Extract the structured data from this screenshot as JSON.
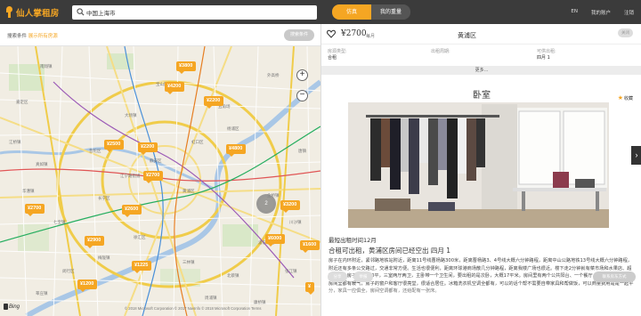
{
  "app": {
    "logo_text": "仙人掌租房"
  },
  "search": {
    "value": "中国上海市",
    "placeholder": ""
  },
  "tabs": [
    {
      "label": "仿真"
    },
    {
      "label": "我的重量"
    }
  ],
  "nav": [
    {
      "label": "EN"
    },
    {
      "label": "我的账户"
    },
    {
      "label": "注销"
    }
  ],
  "filter": {
    "text_prefix": "搜索条件 ",
    "text_highlight": "展示所有房源",
    "button_label": "搜索条件"
  },
  "map": {
    "pins": [
      {
        "label": "¥3800"
      },
      {
        "label": "¥4200"
      },
      {
        "label": "¥2200"
      },
      {
        "label": "¥2500"
      },
      {
        "label": "¥2200"
      },
      {
        "label": "¥4800"
      },
      {
        "label": "¥2700"
      },
      {
        "label": "¥2600"
      },
      {
        "label": "¥2700"
      },
      {
        "label": "¥3200"
      },
      {
        "label": "¥2900"
      },
      {
        "label": "¥6000"
      },
      {
        "label": "¥1600"
      },
      {
        "label": "¥1225"
      },
      {
        "label": "¥1200"
      },
      {
        "label": "¥"
      }
    ],
    "cluster_count": "2",
    "labels": [
      "宝山区",
      "嘉定区",
      "普陀区",
      "静安区",
      "黄浦区",
      "长宁区",
      "徐汇区",
      "闵行区",
      "浦东新区",
      "杨浦区",
      "虹口区",
      "江宁路街道",
      "真如镇",
      "外高桥",
      "张江镇",
      "北蔡镇",
      "三林镇",
      "梅陇镇",
      "莘庄镇",
      "七宝镇",
      "华漕镇",
      "江桥镇",
      "南翔镇",
      "大场镇",
      "五角场",
      "金桥镇",
      "康桥镇",
      "周浦镇",
      "川沙镇",
      "唐镇"
    ],
    "bing_label": "Bing",
    "copyright": "© 2018 Microsoft Corporation  © 2017 NavInfo  © 2018 Microsoft Corporation  Terms"
  },
  "listing": {
    "price": "¥2700",
    "unit": "每月",
    "district": "黄浦区",
    "close_label": "关闭",
    "info": [
      {
        "label": "房源类型:",
        "value": "合租"
      },
      {
        "label": "出租周期:",
        "value": ""
      },
      {
        "label": "可供出租:",
        "value": "四月 1"
      }
    ],
    "more_label": "更多...",
    "room_title": "卧室",
    "fav_label": "收藏",
    "available": "最短出租时间12月",
    "title": "合租可出租，黄浦区房间已经空出 四月 1",
    "description": "房子在内环附近，紧邻路地铁站附近，距离11号线曹杨路300米，距离曹杨路3、4号线大概六分钟路程，距离中山公路地铁13号线大概六分钟路程，附近还有多条公交路过，交通非常方便。生活也很便利，距离环球港商场散几分钟路程，距离我楼广场也很近。楼下走2分钟就有菜市场和水果店、超市。这个房子一共150平，三室两厅两卫，主卧带一个卫生间，要出租的是次卧，大概17平米。房间里有两个公共阳台、一个餐厅、一个客厅，每个房间里都有暖气，房子的窗户和客厅很亮堂，很适合居住。冰箱洗衣机空调全都有，可以的话个帮不需要自带家具和帮做饭，可以商量费用是是一起平分，家具一应俱全，房间空调都有，还给配有一张床。",
    "buttons": [
      {
        "label": "分享"
      },
      {
        "label": "举报"
      }
    ],
    "contact_label": "联系房东方式"
  }
}
